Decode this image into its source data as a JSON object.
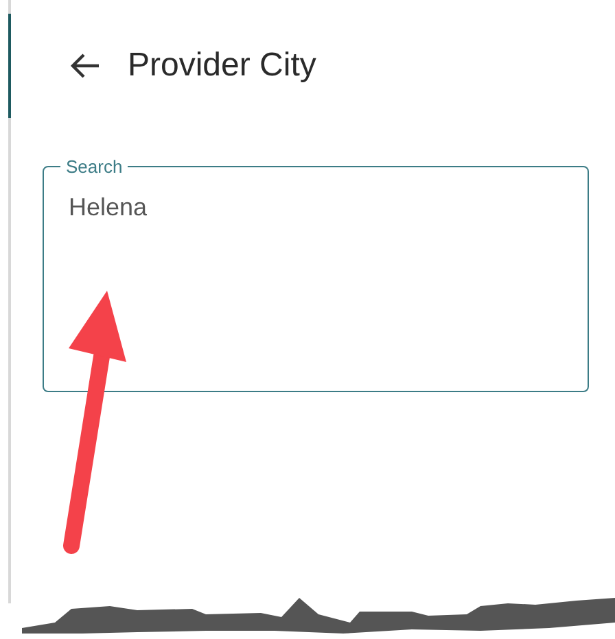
{
  "header": {
    "title": "Provider City"
  },
  "search": {
    "label": "Search",
    "value": "Helena"
  }
}
